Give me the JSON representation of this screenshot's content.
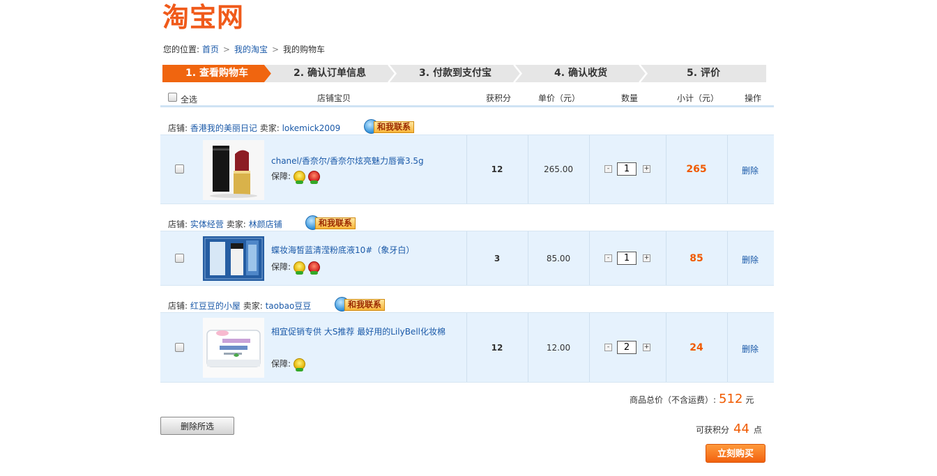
{
  "logo": {
    "text": "淘宝网"
  },
  "breadcrumb": {
    "prefix": "您的位置:",
    "items": [
      "首页",
      "我的淘宝",
      "我的购物车"
    ]
  },
  "steps": [
    "1. 查看购物车",
    "2. 确认订单信息",
    "3. 付款到支付宝",
    "4. 确认收货",
    "5. 评价"
  ],
  "table_header": {
    "select_all": "全选",
    "item": "店铺宝贝",
    "points": "获积分",
    "unit_price": "单价（元）",
    "quantity": "数量",
    "subtotal": "小计（元）",
    "action": "操作"
  },
  "shops": [
    {
      "shop_label": "店铺:",
      "shop_name": "香港我的美丽日记",
      "seller_label": "卖家:",
      "seller_name": "lokemick2009",
      "contact_label": "和我联系",
      "item": {
        "title": "chanel/香奈尔/香奈尔炫亮魅力唇膏3.5g",
        "guarantee_label": "保障:",
        "points": "12",
        "price": "265.00",
        "quantity": "1",
        "subtotal": "265",
        "delete_label": "删除"
      }
    },
    {
      "shop_label": "店铺:",
      "shop_name": "实体经营",
      "seller_label": "卖家:",
      "seller_name": "林颜店铺",
      "contact_label": "和我联系",
      "item": {
        "title": "蝶妆海皙蓝清滢粉底液10#（象牙白）",
        "guarantee_label": "保障:",
        "points": "3",
        "price": "85.00",
        "quantity": "1",
        "subtotal": "85",
        "delete_label": "删除"
      }
    },
    {
      "shop_label": "店铺:",
      "shop_name": "红豆豆的小屋",
      "seller_label": "卖家:",
      "seller_name": "taobao豆豆",
      "contact_label": "和我联系",
      "item": {
        "title": "相宜促销专供 大S推荐 最好用的LilyBell化妆棉",
        "guarantee_label": "保障:",
        "points": "12",
        "price": "12.00",
        "quantity": "2",
        "subtotal": "24",
        "delete_label": "删除"
      }
    }
  ],
  "summary": {
    "total_label": "商品总价（不含运费）:",
    "total_value": "512",
    "total_unit": "元",
    "points_label": "可获积分",
    "points_value": "44",
    "points_unit": "点"
  },
  "buttons": {
    "delete_selected": "删除所选",
    "buy_now": "立刻购买"
  },
  "colors": {
    "accent": "#f05a1a",
    "link": "#1a59a8",
    "row_bg": "#e6f2fd",
    "price": "#f05a00"
  }
}
